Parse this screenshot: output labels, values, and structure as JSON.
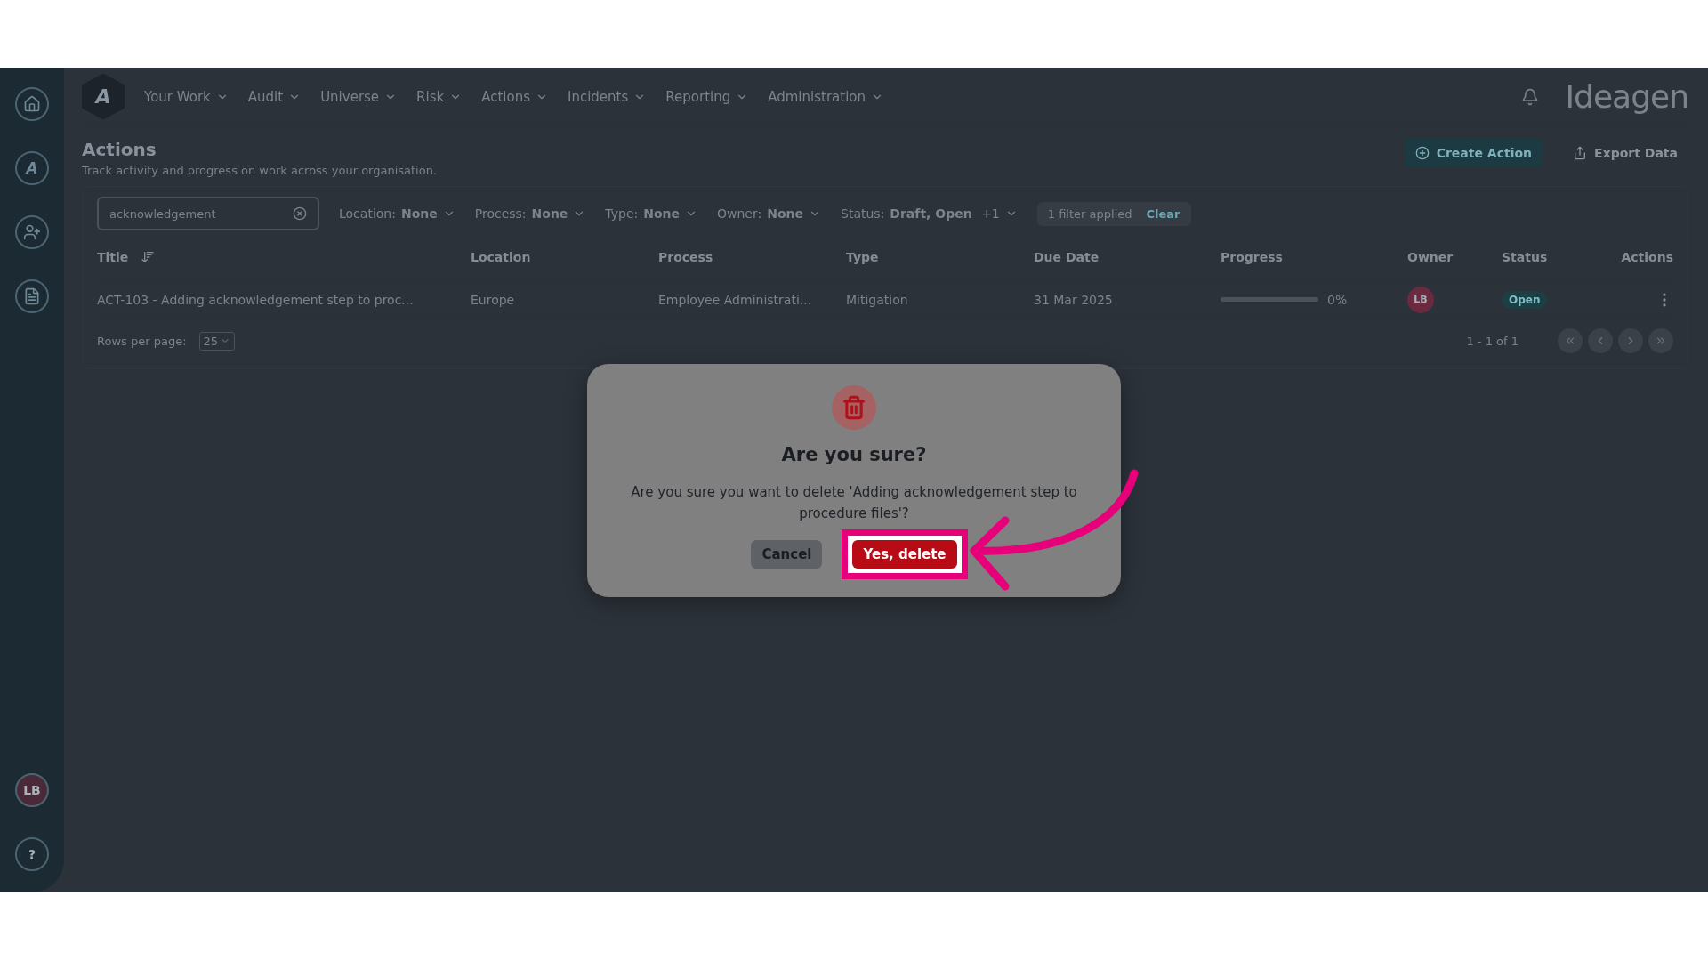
{
  "sidebar": {
    "items": [
      {
        "kind": "home",
        "selected": false
      },
      {
        "kind": "logo",
        "label": "A",
        "selected": false
      },
      {
        "kind": "people",
        "selected": false
      },
      {
        "kind": "document",
        "selected": false
      }
    ],
    "user_initials": "LB",
    "help": "?"
  },
  "top_nav": {
    "logo": "A",
    "items": [
      "Your Work",
      "Audit",
      "Universe",
      "Risk",
      "Actions",
      "Incidents",
      "Reporting",
      "Administration"
    ],
    "brand": "Ideagen"
  },
  "page": {
    "title": "Actions",
    "subtitle": "Track activity and progress on work across your organisation.",
    "buttons": [
      {
        "kind": "primary",
        "label": "Create Action"
      },
      {
        "kind": "secondary",
        "label": "Export Data"
      }
    ]
  },
  "filters": {
    "search": {
      "value": "acknowledgement"
    },
    "dropdowns": [
      {
        "label": "Location:",
        "value": "None"
      },
      {
        "label": "Process:",
        "value": "None"
      },
      {
        "label": "Type:",
        "value": "None"
      },
      {
        "label": "Owner:",
        "value": "None"
      },
      {
        "label": "Status:",
        "value": "Draft, Open",
        "extra": "+1"
      }
    ],
    "applied": "1 filter applied",
    "clear": "Clear"
  },
  "table": {
    "columns": [
      "Title",
      "Location",
      "Process",
      "Type",
      "Due Date",
      "Progress",
      "Owner",
      "Status",
      "Actions"
    ],
    "rows": [
      {
        "title": "ACT-103 - Adding acknowledgement step to proc...",
        "location": "Europe",
        "process": "Employee Administrati...",
        "type": "Mitigation",
        "due_date": "31 Mar 2025",
        "level": 0,
        "progress": "0%",
        "owner": "LB",
        "status": "Open"
      }
    ],
    "rows_per_page_label": "Rows per page:",
    "rows_per_page": "25",
    "range": "1 - 1 of 1"
  },
  "dialog": {
    "title": "Are you sure?",
    "message": "Are you sure you want to delete 'Adding acknowledgement step to procedure files'?",
    "buttons": [
      {
        "kind": "cancel",
        "label": "Cancel",
        "highlighted": false
      },
      {
        "kind": "danger",
        "label": "Yes, delete",
        "highlighted": true
      }
    ]
  }
}
